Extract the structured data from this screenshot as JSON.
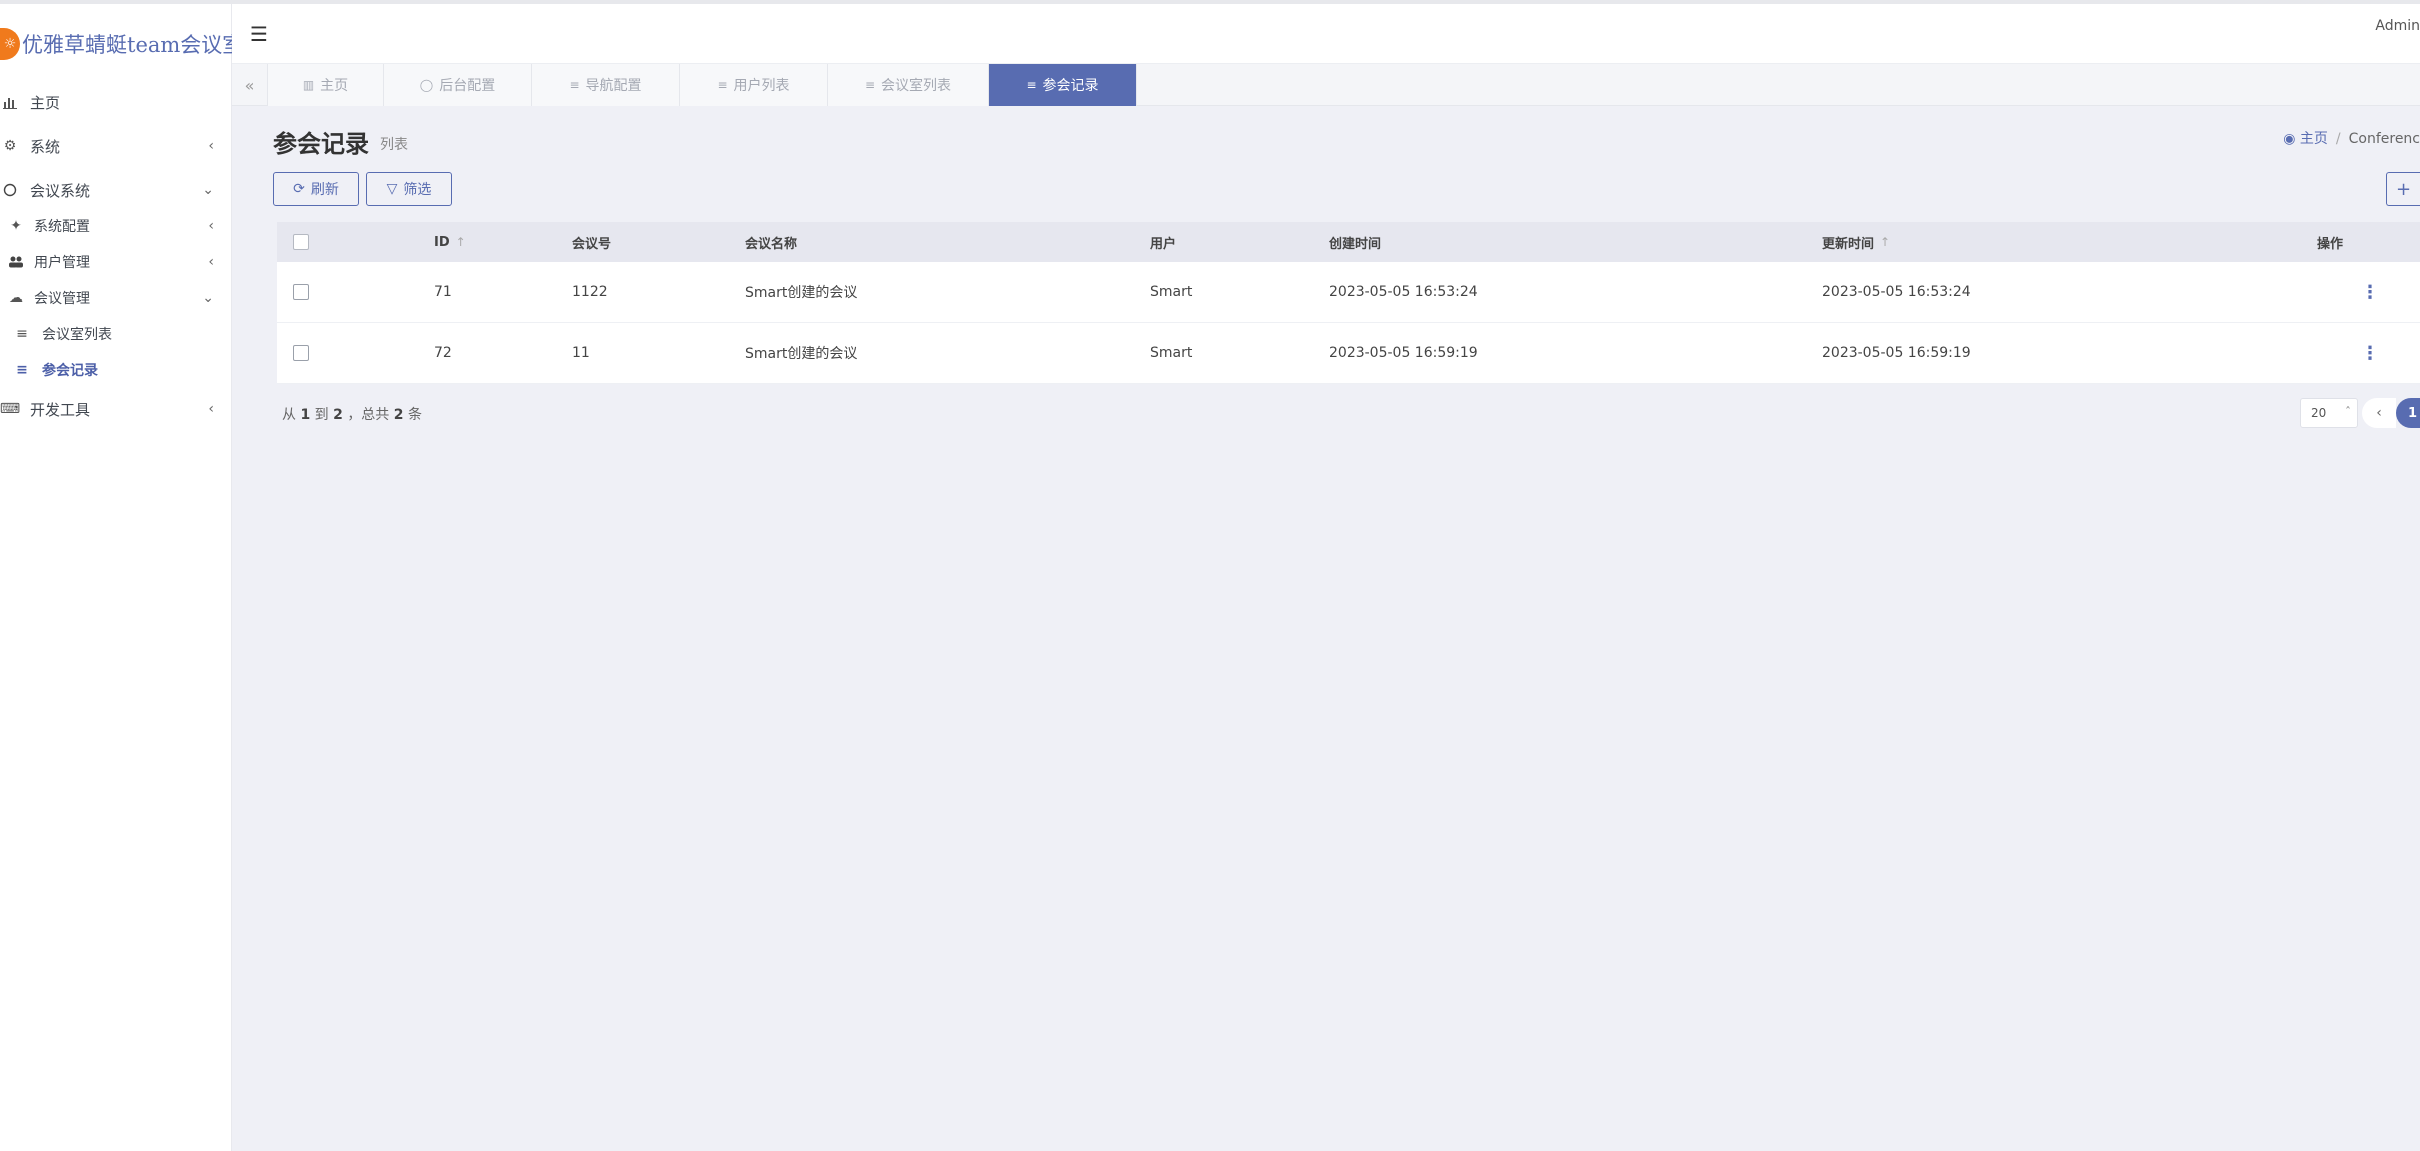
{
  "app": {
    "title": "优雅草蜻蜓team会议室",
    "user": "Admin"
  },
  "sidebar": {
    "items": [
      {
        "label": "主页",
        "icon": "bar-chart-icon"
      },
      {
        "label": "系统",
        "icon": "gear-icon"
      },
      {
        "label": "会议系统",
        "icon": "circle-icon"
      },
      {
        "label": "系统配置",
        "icon": "wrench-icon"
      },
      {
        "label": "用户管理",
        "icon": "users-icon"
      },
      {
        "label": "会议管理",
        "icon": "cloud-icon"
      },
      {
        "label": "会议室列表",
        "icon": "list-icon"
      },
      {
        "label": "参会记录",
        "icon": "list-icon"
      },
      {
        "label": "开发工具",
        "icon": "keyboard-icon"
      }
    ]
  },
  "tabs": [
    {
      "label": "主页",
      "icon": "bar-chart-icon"
    },
    {
      "label": "后台配置",
      "icon": "toggle-icon"
    },
    {
      "label": "导航配置",
      "icon": "list-icon"
    },
    {
      "label": "用户列表",
      "icon": "list-icon"
    },
    {
      "label": "会议室列表",
      "icon": "list-icon"
    },
    {
      "label": "参会记录",
      "icon": "list-icon"
    }
  ],
  "page": {
    "title": "参会记录",
    "subtitle": "列表",
    "breadcrumb": {
      "home": "主页",
      "separator": "/",
      "current": "Conferenc"
    }
  },
  "toolbar": {
    "refresh": "刷新",
    "filter": "筛选",
    "create": "+"
  },
  "table": {
    "columns": [
      "ID",
      "会议号",
      "会议名称",
      "用户",
      "创建时间",
      "更新时间",
      "操作"
    ],
    "rows": [
      [
        "71",
        "1122",
        "Smart创建的会议",
        "Smart",
        "2023-05-05 16:53:24",
        "2023-05-05 16:53:24"
      ],
      [
        "72",
        "11",
        "Smart创建的会议",
        "Smart",
        "2023-05-05 16:59:19",
        "2023-05-05 16:59:19"
      ]
    ]
  },
  "pagination": {
    "from_label": "从",
    "from": "1",
    "to_label": "到",
    "to": "2",
    "total_label": "，总共",
    "total": "2",
    "unit": "条",
    "per_page": "20",
    "current_page": "1"
  },
  "colors": {
    "accent": "#586cb1",
    "brand_logo": "#f07a1c",
    "content_bg": "#eff0f6"
  }
}
